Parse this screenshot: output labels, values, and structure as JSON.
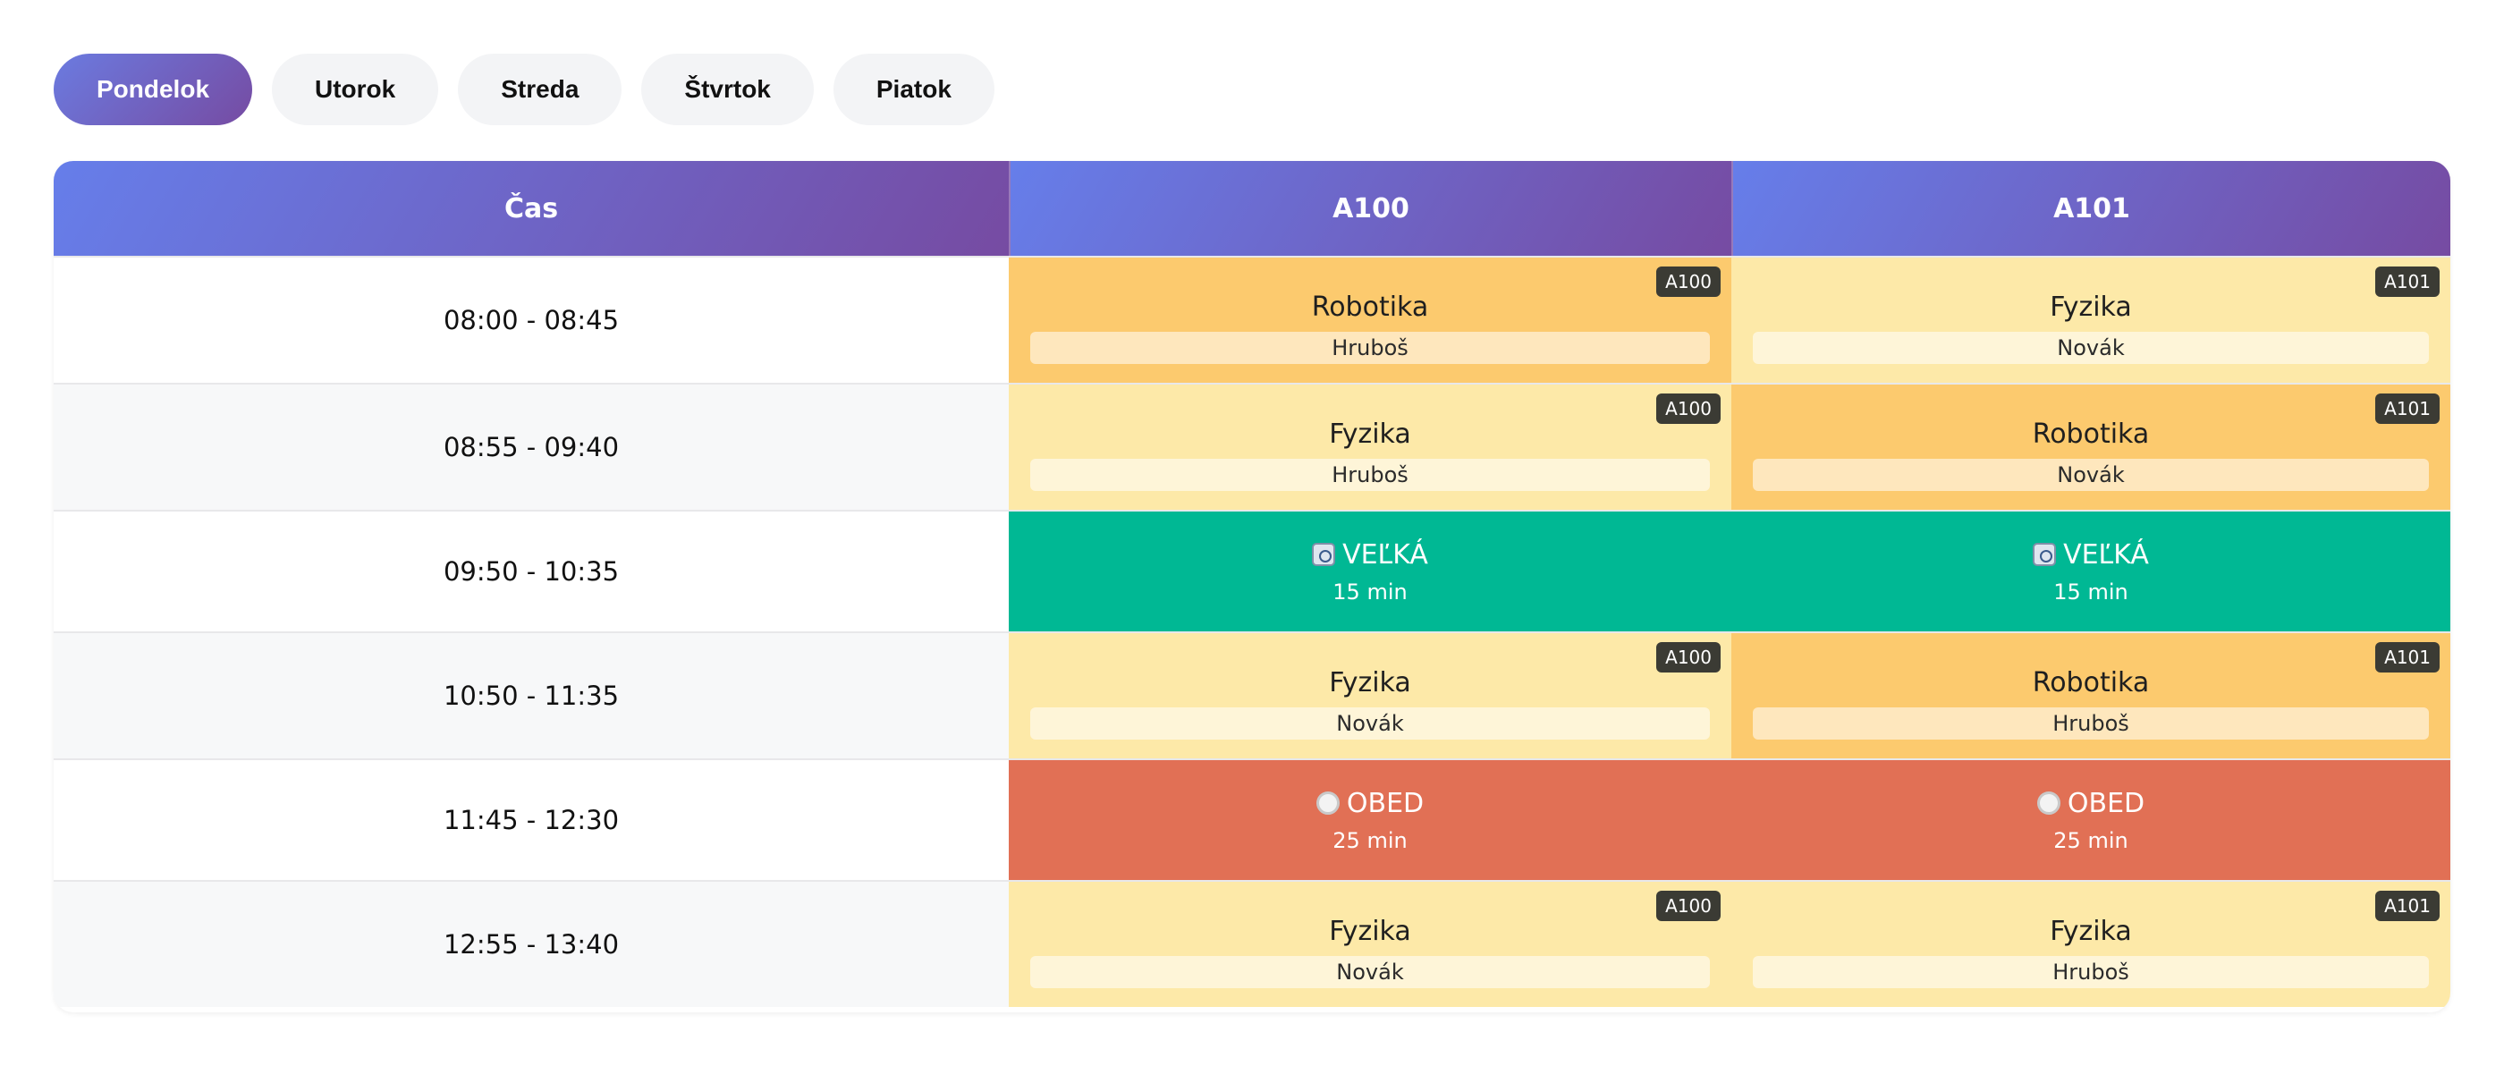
{
  "tabs": [
    {
      "label": "Pondelok",
      "active": true
    },
    {
      "label": "Utorok",
      "active": false
    },
    {
      "label": "Streda",
      "active": false
    },
    {
      "label": "Štvrtok",
      "active": false
    },
    {
      "label": "Piatok",
      "active": false
    }
  ],
  "colors": {
    "accent_start": "#667eea",
    "accent_end": "#764ba2",
    "lesson_light": "#fde9a8",
    "lesson_dark": "#fcca6e",
    "break_green": "#00b894",
    "lunch_red": "#e17055"
  },
  "table": {
    "headers": {
      "time": "Čas",
      "room1": "A100",
      "room2": "A101"
    },
    "rows": [
      {
        "time": "08:00 - 08:45",
        "c1": {
          "subject": "Robotika",
          "teacher": "Hruboš",
          "room": "A100"
        },
        "c2": {
          "subject": "Fyzika",
          "teacher": "Novák",
          "room": "A101"
        }
      },
      {
        "time": "08:55 - 09:40",
        "c1": {
          "subject": "Fyzika",
          "teacher": "Hruboš",
          "room": "A100"
        },
        "c2": {
          "subject": "Robotika",
          "teacher": "Novák",
          "room": "A101"
        }
      },
      {
        "time": "09:50 - 10:35",
        "c1": {
          "title": "VEĽKÁ",
          "duration": "15 min",
          "icon": "clock-icon"
        },
        "c2": {
          "title": "VEĽKÁ",
          "duration": "15 min",
          "icon": "clock-icon"
        }
      },
      {
        "time": "10:50 - 11:35",
        "c1": {
          "subject": "Fyzika",
          "teacher": "Novák",
          "room": "A100"
        },
        "c2": {
          "subject": "Robotika",
          "teacher": "Hruboš",
          "room": "A101"
        }
      },
      {
        "time": "11:45 - 12:30",
        "c1": {
          "title": "OBED",
          "duration": "25 min",
          "icon": "plate-icon"
        },
        "c2": {
          "title": "OBED",
          "duration": "25 min",
          "icon": "plate-icon"
        }
      },
      {
        "time": "12:55 - 13:40",
        "c1": {
          "subject": "Fyzika",
          "teacher": "Novák",
          "room": "A100"
        },
        "c2": {
          "subject": "Fyzika",
          "teacher": "Hruboš",
          "room": "A101"
        }
      }
    ]
  }
}
